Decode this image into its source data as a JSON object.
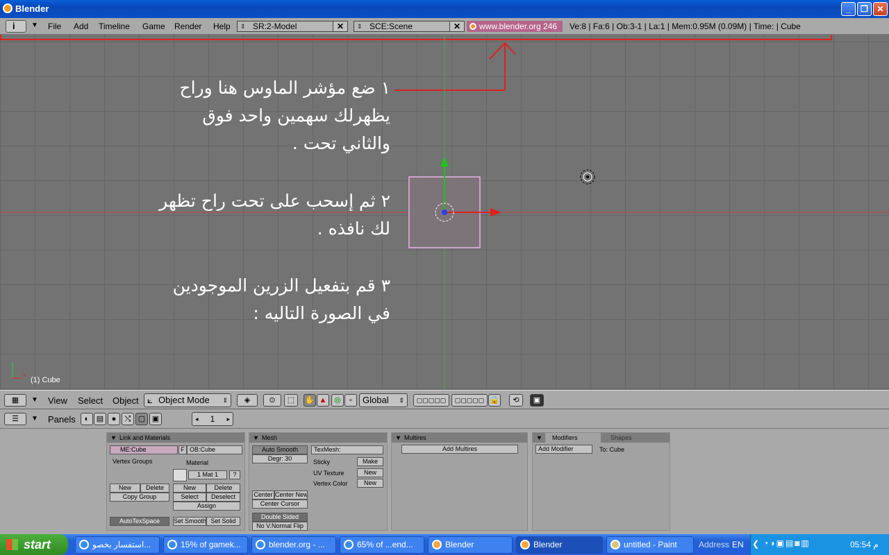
{
  "window": {
    "title": "Blender"
  },
  "top_header": {
    "menus": [
      "File",
      "Add",
      "Timeline",
      "Game",
      "Render",
      "Help"
    ],
    "screen_field": "SR:2-Model",
    "scene_field": "SCE:Scene",
    "url": "www.blender.org 246",
    "stats": "Ve:8 | Fa:6 | Ob:3-1 | La:1  | Mem:0.95M (0.09M)  | Time: | Cube"
  },
  "viewport": {
    "instructions": [
      [
        "١ ضع مؤشر الماوس هنا وراح",
        "يظهرلك سهمين واحد فوق",
        "والثاني تحت ."
      ],
      [
        "٢ ثم إسحب على تحت راح تظهر",
        "لك نافذه ."
      ],
      [
        "٣ قم بتفعيل الزرين الموجودين",
        "في الصورة التاليه :"
      ]
    ],
    "object_label": "(1) Cube",
    "axis_label": "x"
  },
  "view_header": {
    "menus": [
      "View",
      "Select",
      "Object"
    ],
    "mode": "Object Mode",
    "orientation": "Global"
  },
  "buttons_header": {
    "panels_label": "Panels",
    "frame": "1"
  },
  "panels": {
    "link_materials": {
      "title": "Link and Materials",
      "me_field": "ME:Cube",
      "f_btn": "F",
      "ob_field": "OB:Cube",
      "vertex_groups": "Vertex Groups",
      "material": "Material",
      "mat_field": "1 Mat 1",
      "question": "?",
      "new": "New",
      "delete": "Delete",
      "copy_group": "Copy Group",
      "mat_new": "New",
      "mat_delete": "Delete",
      "select": "Select",
      "deselect": "Deselect",
      "assign": "Assign",
      "autotexspace": "AutoTexSpace",
      "set_smooth": "Set Smooth",
      "set_solid": "Set Solid"
    },
    "mesh": {
      "title": "Mesh",
      "auto_smooth": "Auto Smooth",
      "degr": "Degr: 30",
      "texmesh": "TexMesh:",
      "sticky": "Sticky",
      "make": "Make",
      "uv_texture": "UV Texture",
      "uv_new": "New",
      "vertex_color": "Vertex Color",
      "vc_new": "New",
      "center": "Center",
      "center_new": "Center New",
      "center_cursor": "Center Cursor",
      "double_sided": "Double Sided",
      "no_vnormal_flip": "No V.Normal Flip"
    },
    "multires": {
      "title": "Multires",
      "add_multires": "Add Multires"
    },
    "modifiers": {
      "tab_modifiers": "Modifiers",
      "tab_shapes": "Shapes",
      "add_modifier": "Add Modifier",
      "to_cube": "To: Cube"
    }
  },
  "taskbar": {
    "start": "start",
    "tasks": [
      "استفسار بخصو...",
      "15% of gamek...",
      "blender.org - ...",
      "65% of ...end...",
      "Blender",
      "Blender",
      "untitled - Paint"
    ],
    "address": "Address",
    "lang": "EN",
    "clock": "05:54 م"
  }
}
